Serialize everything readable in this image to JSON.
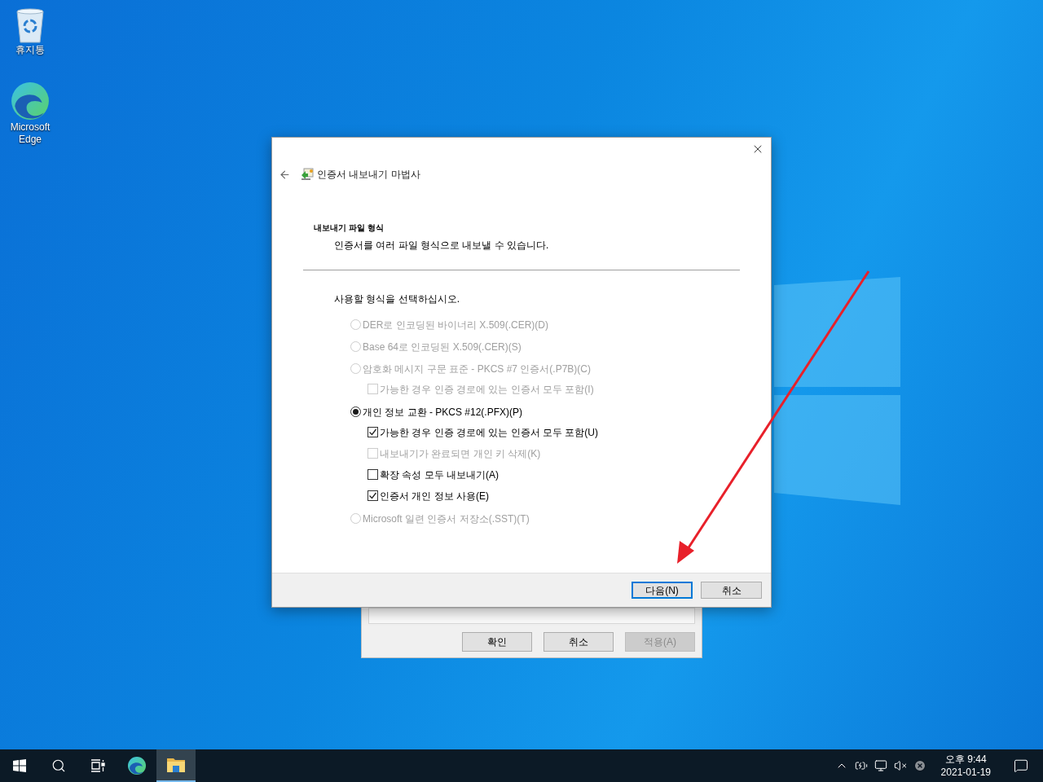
{
  "desktop_icons": [
    {
      "kind": "recycle-bin",
      "label": "휴지통"
    },
    {
      "kind": "browser",
      "label": "Microsoft Edge"
    }
  ],
  "back_dialog": {
    "buttons": [
      {
        "label": "확인",
        "disabled": false
      },
      {
        "label": "취소",
        "disabled": false
      },
      {
        "label": "적용(A)",
        "disabled": true
      }
    ]
  },
  "wizard": {
    "title": "인증서 내보내기 마법사",
    "heading": "내보내기 파일 형식",
    "subtitle": "인증서를 여러 파일 형식으로 내보낼 수 있습니다.",
    "prompt": "사용할 형식을 선택하십시오.",
    "options": [
      {
        "label": "DER로 인코딩된 바이너리 X.509(.CER)(D)",
        "selected": false,
        "disabled": true
      },
      {
        "label": "Base 64로 인코딩된 X.509(.CER)(S)",
        "selected": false,
        "disabled": true
      },
      {
        "label": "암호화 메시지 구문 표준 - PKCS #7 인증서(.P7B)(C)",
        "selected": false,
        "disabled": true,
        "children": [
          {
            "label": "가능한 경우 인증 경로에 있는 인증서 모두 포함(I)",
            "checked": false,
            "disabled": true
          }
        ]
      },
      {
        "label": "개인 정보 교환 - PKCS #12(.PFX)(P)",
        "selected": true,
        "disabled": false,
        "children": [
          {
            "label": "가능한 경우 인증 경로에 있는 인증서 모두 포함(U)",
            "checked": true,
            "disabled": false
          },
          {
            "label": "내보내기가 완료되면 개인 키 삭제(K)",
            "checked": false,
            "disabled": true
          },
          {
            "label": "확장 속성 모두 내보내기(A)",
            "checked": false,
            "disabled": false
          },
          {
            "label": "인증서 개인 정보 사용(E)",
            "checked": true,
            "disabled": false
          }
        ]
      },
      {
        "label": "Microsoft 일련 인증서 저장소(.SST)(T)",
        "selected": false,
        "disabled": true
      }
    ],
    "buttons": [
      {
        "label": "다음(N)",
        "default": true
      },
      {
        "label": "취소",
        "default": false
      }
    ]
  },
  "taskbar": {
    "items": [
      {
        "kind": "start",
        "selected": false
      },
      {
        "kind": "search",
        "selected": false
      },
      {
        "kind": "task-view",
        "selected": false
      },
      {
        "kind": "browser",
        "selected": false
      },
      {
        "kind": "folder",
        "selected": true
      }
    ],
    "tray": [
      {
        "kind": "chevron"
      },
      {
        "kind": "power"
      },
      {
        "kind": "network"
      },
      {
        "kind": "mute"
      },
      {
        "kind": "error"
      }
    ],
    "time": "오후 9:44",
    "date": "2021-01-19"
  }
}
